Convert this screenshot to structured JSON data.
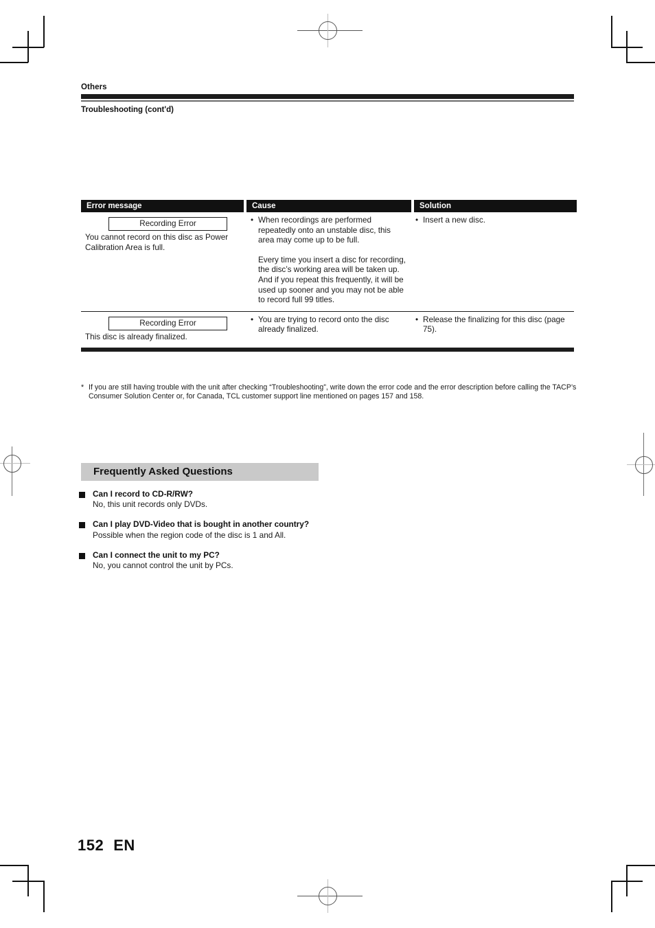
{
  "header": {
    "chapter": "Others",
    "section_title": "Troubleshooting (cont'd)"
  },
  "table": {
    "columns": [
      "Error message",
      "Cause",
      "Solution"
    ],
    "rows": [
      {
        "error_box": "Recording Error",
        "error_desc": "You cannot record on this disc as Power Calibration Area is full.",
        "cause_bullet": "When recordings are performed repeatedly onto an unstable disc, this area may come up to be full.",
        "cause_extra": "Every time you insert a disc for recording, the disc’s working area will be taken up.  And if you repeat this frequently, it will be used up sooner and you may not be able to record full 99 titles.",
        "solution_bullet": "Insert a new disc."
      },
      {
        "error_box": "Recording Error",
        "error_desc": "This disc is already finalized.",
        "cause_bullet": "You are trying to record onto the disc already finalized.",
        "cause_extra": "",
        "solution_bullet": "Release the finalizing for this disc (page 75)."
      }
    ]
  },
  "footnote": {
    "marker": "*",
    "text": "If you are still having trouble with the unit after checking “Troubleshooting”, write down the error code and the error description before calling the TACP’s Consumer Solution Center or, for Canada, TCL customer support line mentioned on pages 157 and 158."
  },
  "faq": {
    "heading": "Frequently Asked Questions",
    "items": [
      {
        "question": "Can I record to CD-R/RW?",
        "answer": "No, this unit records only DVDs."
      },
      {
        "question": "Can I play DVD-Video that is bought in another country?",
        "answer": "Possible when the region code of the disc is 1 and All."
      },
      {
        "question": "Can I connect the unit to my PC?",
        "answer": "No, you cannot control the unit by PCs."
      }
    ]
  },
  "footer": {
    "page_number": "152",
    "language_code": "EN"
  },
  "colors": {
    "rule_dark": "#1c1c1c",
    "rule_grey": "#6a6a6a",
    "faq_band": "#c9c9c9",
    "text": "#1a1a1a"
  }
}
